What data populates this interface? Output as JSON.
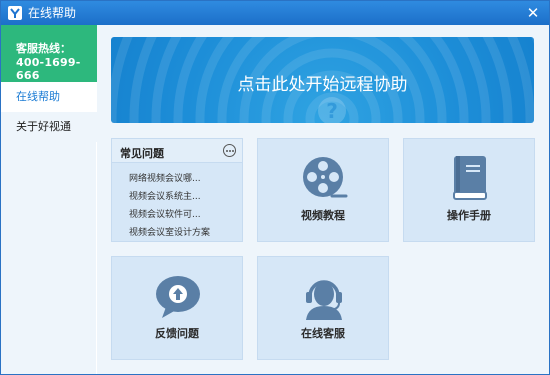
{
  "window": {
    "title": "在线帮助"
  },
  "sidebar": {
    "hotline_label": "客服热线：",
    "hotline_number": "400-1699-666",
    "items": [
      {
        "label": "在线帮助",
        "active": true
      },
      {
        "label": "关于好视通",
        "active": false
      }
    ]
  },
  "banner": {
    "text": "点击此处开始远程协助",
    "bg_icon": "question-mark-icon"
  },
  "faq": {
    "title": "常见问题",
    "more_icon": "more-dots-icon",
    "items": [
      "网络视频会议哪...",
      "视频会议系统主...",
      "视频会议软件可...",
      "视频会议室设计方案"
    ]
  },
  "tiles": {
    "video_tutorial": {
      "label": "视频教程",
      "icon": "film-reel-icon"
    },
    "manual": {
      "label": "操作手册",
      "icon": "book-icon"
    },
    "feedback": {
      "label": "反馈问题",
      "icon": "speech-bubble-upload-icon"
    },
    "support": {
      "label": "在线客服",
      "icon": "headset-agent-icon"
    }
  },
  "colors": {
    "title_bar": "#1e74cf",
    "hotline_bg": "#2db87d",
    "accent": "#1a7bd4",
    "banner_bg": "#1d8ed8",
    "tile_bg": "#d6e7f7",
    "icon": "#5a7fa6"
  }
}
